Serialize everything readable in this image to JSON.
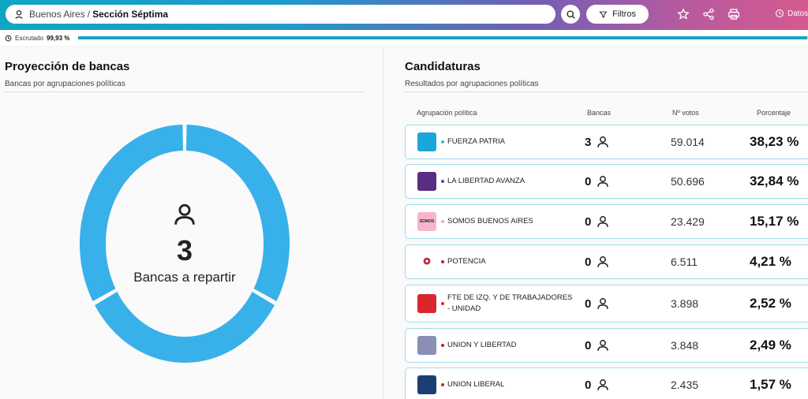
{
  "header": {
    "location": "Buenos Aires",
    "separator": "/",
    "section": "Sección Séptima",
    "filters_label": "Filtros",
    "datos_label": "Datos"
  },
  "progress": {
    "label": "Escrutado",
    "value_text": "99,93 %",
    "value": 99.93
  },
  "left": {
    "title": "Proyección de bancas",
    "subtitle": "Bancas por agrupaciones políticas",
    "seats_total": "3",
    "seats_label": "Bancas a repartir",
    "donut_color": "#38b1ea"
  },
  "right": {
    "title": "Candidaturas",
    "subtitle": "Resultados por agrupaciones políticas",
    "columns": [
      "Agrupación política",
      "Bancas",
      "Nº votos",
      "Porcentaje"
    ],
    "rows": [
      {
        "party": "FUERZA PATRIA",
        "seats": "3",
        "votes": "59.014",
        "pct": "38,23 %",
        "dot": "#3ab6e6",
        "logo_bg": "#1ba6d9",
        "logo_text": ""
      },
      {
        "party": "LA LIBERTAD AVANZA",
        "seats": "0",
        "votes": "50.696",
        "pct": "32,84 %",
        "dot": "#6c3c9c",
        "logo_bg": "#5a2d82",
        "logo_text": ""
      },
      {
        "party": "SOMOS BUENOS AIRES",
        "seats": "0",
        "votes": "23.429",
        "pct": "15,17 %",
        "dot": "#f2a7c5",
        "logo_bg": "#f7b5cc",
        "logo_text": "SOMOS"
      },
      {
        "party": "POTENCIA",
        "seats": "0",
        "votes": "6.511",
        "pct": "4,21 %",
        "dot": "#c21f3a",
        "logo_bg": "#ffffff",
        "logo_text": ""
      },
      {
        "party": "FTE DE IZQ. Y DE TRABAJADORES - UNIDAD",
        "seats": "0",
        "votes": "3.898",
        "pct": "2,52 %",
        "dot": "#d3262f",
        "logo_bg": "#d9272e",
        "logo_text": ""
      },
      {
        "party": "UNION Y LIBERTAD",
        "seats": "0",
        "votes": "3.848",
        "pct": "2,49 %",
        "dot": "#c21f3a",
        "logo_bg": "#8a8fb5",
        "logo_text": ""
      },
      {
        "party": "UNION LIBERAL",
        "seats": "0",
        "votes": "2.435",
        "pct": "1,57 %",
        "dot": "#c21f3a",
        "logo_bg": "#1b3f73",
        "logo_text": ""
      }
    ]
  }
}
